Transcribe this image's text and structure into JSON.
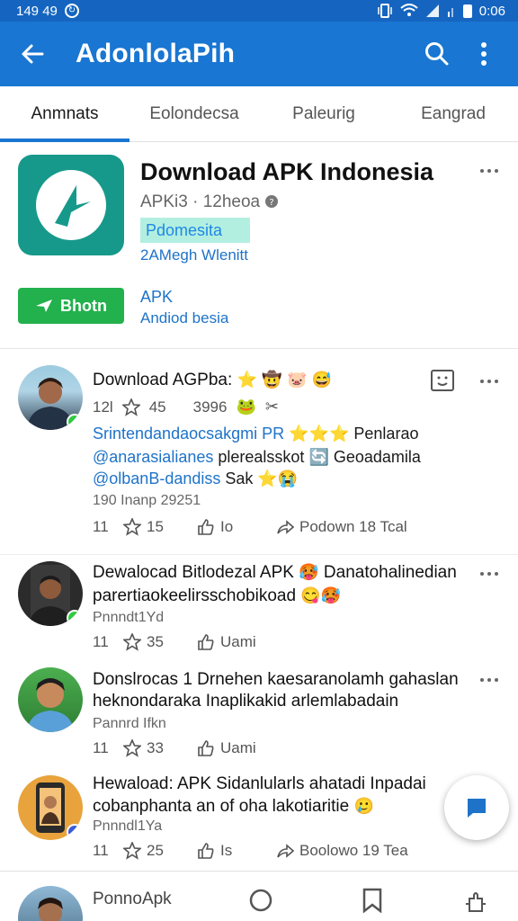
{
  "status": {
    "time": "149 49",
    "battery_time": "0:06"
  },
  "appbar": {
    "title": "AdonlolaPih"
  },
  "tabs": [
    {
      "label": "Anmnats",
      "active": true
    },
    {
      "label": "Eolondecsa",
      "active": false
    },
    {
      "label": "Paleurig",
      "active": false
    },
    {
      "label": "Eangrad",
      "active": false
    }
  ],
  "app": {
    "name": "Download APK Indonesia",
    "meta": "APKi3 · 12heoa",
    "tag": "Pdomesita",
    "link": "2AMegh Wlenitt",
    "download_label": "Bhotn",
    "type_label": "APK",
    "type_sub": "Andiod besia"
  },
  "posts": [
    {
      "title": "Download AGPba:",
      "stats_left": "12l",
      "stars": "45",
      "stat_right": "3996",
      "line1_blue": "Srintendandaocsakgmi PR",
      "line1_black": "Penlarao",
      "line2_blue": "@anarasialianes",
      "line2_black": "plerealsskot",
      "line2_end": "Geoadamila",
      "line3_blue": "@olbanB-dandiss",
      "line3_black": "Sak",
      "meta": "190 Inanp 29251",
      "act_count": "11",
      "act_stars": "15",
      "act_like": "Io",
      "act_share": "Podown 18 Tcal"
    },
    {
      "title": "Dewalocad Bitlodezal APK",
      "title_end": "Danatohalinedian",
      "line2": "parertiaokeelirsschobikoad",
      "meta": "Pnnndt1Yd",
      "act_count": "11",
      "act_stars": "35",
      "act_like": "Uami"
    },
    {
      "title": "Donslrocas 1 Drnehen kaesaranolamh gahaslan",
      "line2": "heknondaraka Inaplikakid arlemlabadain",
      "meta": "Pannrd Ifkn",
      "act_count": "11",
      "act_stars": "33",
      "act_like": "Uami"
    },
    {
      "title": "Hewaload: APK Sidanlularls ahatadi Inpadai",
      "line2": "cobanphanta an of oha lakotiaritie",
      "meta": "Pnnndl1Ya",
      "act_count": "11",
      "act_stars": "25",
      "act_like": "Is",
      "act_share": "Boolowo 19 Tea"
    }
  ],
  "bottom": {
    "label": "PonnoApk"
  },
  "colors": {
    "appbar": "#1976d2",
    "statusbar": "#1565c0",
    "accent": "#1e73c9",
    "download": "#22b14c",
    "app_icon": "#16998a"
  }
}
